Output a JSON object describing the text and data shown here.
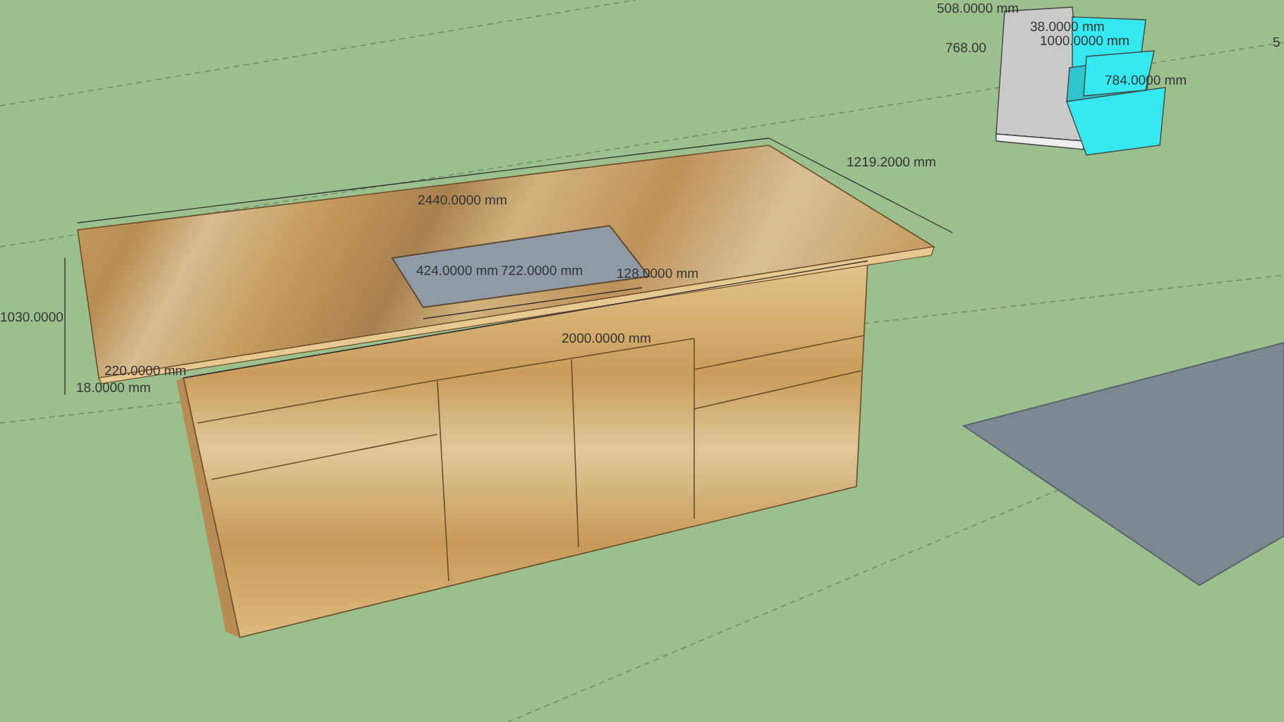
{
  "viewport": {
    "dimension_labels": [
      {
        "text": "2440.0000 mm"
      },
      {
        "text": "1219.2000 mm"
      },
      {
        "text": "424.0000 mm"
      },
      {
        "text": "722.0000 mm"
      },
      {
        "text": "128.0000 mm"
      },
      {
        "text": "2000.0000 mm"
      },
      {
        "text": "1030.0000"
      },
      {
        "text": "220.0000 mm"
      },
      {
        "text": "18.0000 mm"
      },
      {
        "text": "508.0000 mm"
      },
      {
        "text": "768.00"
      },
      {
        "text": "38.0000 mm"
      },
      {
        "text": "1000.0000 mm"
      },
      {
        "text": "784.0000 mm"
      },
      {
        "text": "5"
      }
    ]
  }
}
